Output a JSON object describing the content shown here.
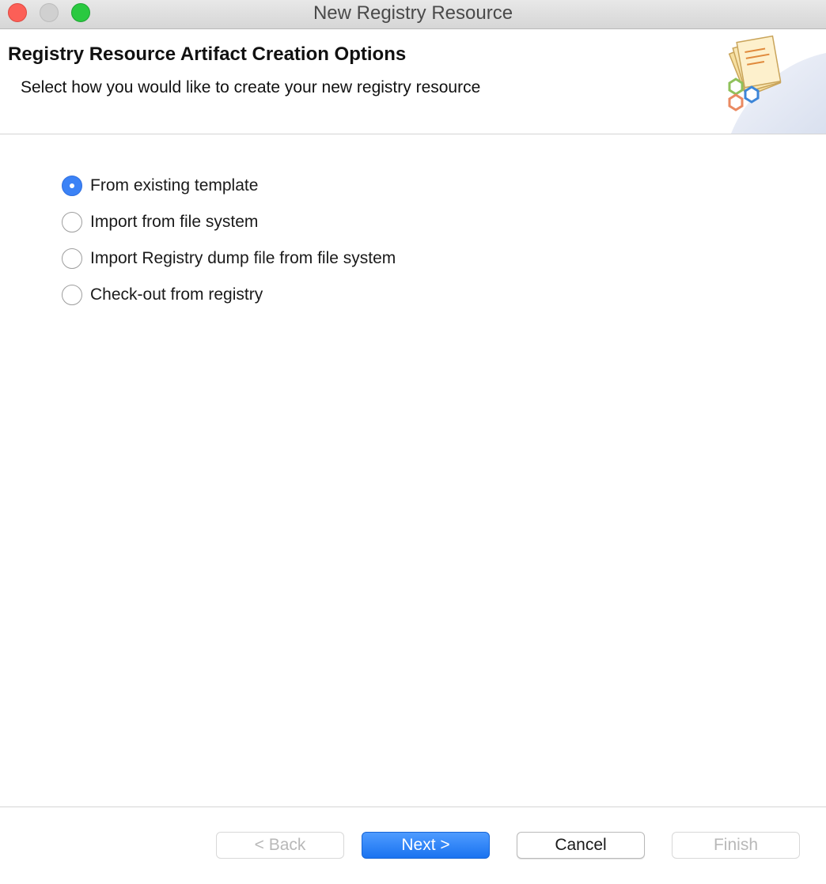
{
  "window": {
    "title": "New Registry Resource"
  },
  "header": {
    "title": "Registry Resource Artifact Creation Options",
    "description": "Select how you would like to create your new registry resource",
    "icon": "registry-resource-wizard-icon"
  },
  "options": [
    {
      "label": "From existing template",
      "selected": true
    },
    {
      "label": "Import from file system",
      "selected": false
    },
    {
      "label": "Import Registry dump file from file system",
      "selected": false
    },
    {
      "label": "Check-out from registry",
      "selected": false
    }
  ],
  "buttons": {
    "back": {
      "label": "< Back",
      "enabled": false
    },
    "next": {
      "label": "Next >",
      "enabled": true
    },
    "cancel": {
      "label": "Cancel",
      "enabled": true
    },
    "finish": {
      "label": "Finish",
      "enabled": false
    }
  },
  "colors": {
    "accent": "#3b82f6",
    "close": "#fc5f57",
    "zoom": "#2ac940"
  }
}
